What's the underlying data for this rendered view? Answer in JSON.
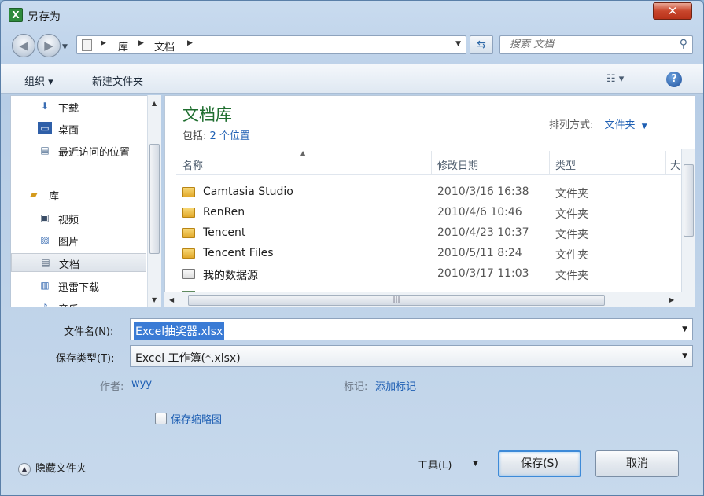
{
  "window": {
    "title": "另存为",
    "app_icon": "excel-icon",
    "close": "✕"
  },
  "nav": {
    "back_icon": "back-arrow-icon",
    "forward_icon": "forward-arrow-icon",
    "breadcrumb": [
      "库",
      "文档"
    ],
    "search_placeholder": "搜索 文档"
  },
  "toolbar": {
    "organize": "组织 ▾",
    "new_folder": "新建文件夹",
    "help": "?"
  },
  "sidebar": {
    "items": [
      {
        "label": "下载",
        "icon": "download-folder-icon"
      },
      {
        "label": "桌面",
        "icon": "desktop-icon"
      },
      {
        "label": "最近访问的位置",
        "icon": "recent-places-icon"
      },
      {
        "label": "库",
        "icon": "library-icon"
      },
      {
        "label": "视频",
        "icon": "video-library-icon"
      },
      {
        "label": "图片",
        "icon": "picture-library-icon"
      },
      {
        "label": "文档",
        "icon": "document-library-icon"
      },
      {
        "label": "迅雷下载",
        "icon": "thunder-download-icon"
      },
      {
        "label": "音乐",
        "icon": "music-library-icon"
      }
    ]
  },
  "library": {
    "title": "文档库",
    "includes_label": "包括:",
    "includes_link": "2 个位置",
    "arrange_label": "排列方式:",
    "arrange_value": "文件夹"
  },
  "table": {
    "columns": [
      "名称",
      "修改日期",
      "类型",
      "大"
    ],
    "rows": [
      {
        "name": "Camtasia Studio",
        "date": "2010/3/16 16:38",
        "type": "文件夹",
        "icon": "folder-icon"
      },
      {
        "name": "RenRen",
        "date": "2010/4/6 10:46",
        "type": "文件夹",
        "icon": "folder-icon"
      },
      {
        "name": "Tencent",
        "date": "2010/4/23 10:37",
        "type": "文件夹",
        "icon": "folder-icon"
      },
      {
        "name": "Tencent Files",
        "date": "2010/5/11 8:24",
        "type": "文件夹",
        "icon": "folder-icon"
      },
      {
        "name": "我的数据源",
        "date": "2010/3/17 11:03",
        "type": "文件夹",
        "icon": "data-source-folder-icon"
      }
    ]
  },
  "form": {
    "filename_label": "文件名(N):",
    "filename_value": "Excel抽奖器.xlsx",
    "filetype_label": "保存类型(T):",
    "filetype_value": "Excel 工作簿(*.xlsx)",
    "author_label": "作者:",
    "author_value": "wyy",
    "tags_label": "标记:",
    "tags_value": "添加标记",
    "thumbnail_label": "保存缩略图"
  },
  "footer": {
    "hide_folders": "隐藏文件夹",
    "tools": "工具(L)",
    "save": "保存(S)",
    "cancel": "取消"
  }
}
